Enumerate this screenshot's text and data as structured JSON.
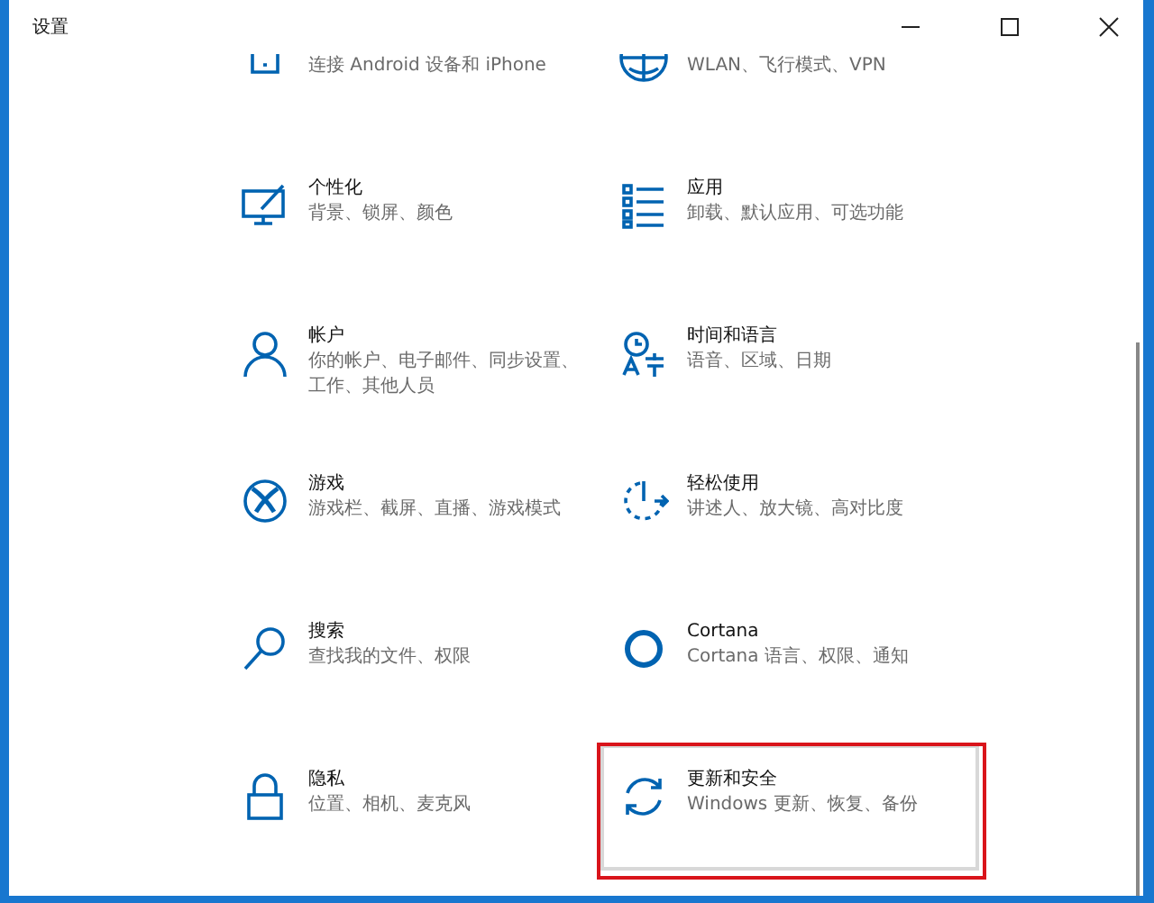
{
  "window": {
    "title": "设置"
  },
  "items": [
    {
      "description": "连接 Android 设备和 iPhone",
      "hovered": false,
      "highlighted": false
    },
    {
      "description": "WLAN、飞行模式、VPN",
      "hovered": false,
      "highlighted": false
    },
    {
      "title": "个性化",
      "description": "背景、锁屏、颜色",
      "hovered": false,
      "highlighted": false
    },
    {
      "title": "应用",
      "description": "卸载、默认应用、可选功能",
      "hovered": false,
      "highlighted": false
    },
    {
      "title": "帐户",
      "description": "你的帐户、电子邮件、同步设置、工作、其他人员",
      "hovered": false,
      "highlighted": false
    },
    {
      "title": "时间和语言",
      "description": "语音、区域、日期",
      "hovered": false,
      "highlighted": false
    },
    {
      "title": "游戏",
      "description": "游戏栏、截屏、直播、游戏模式",
      "hovered": false,
      "highlighted": false
    },
    {
      "title": "轻松使用",
      "description": "讲述人、放大镜、高对比度",
      "hovered": false,
      "highlighted": false
    },
    {
      "title": "搜索",
      "description": "查找我的文件、权限",
      "hovered": false,
      "highlighted": false
    },
    {
      "title": "Cortana",
      "description": "Cortana 语言、权限、通知",
      "hovered": false,
      "highlighted": false
    },
    {
      "title": "隐私",
      "description": "位置、相机、麦克风",
      "hovered": false,
      "highlighted": false
    },
    {
      "title": "更新和安全",
      "description": "Windows 更新、恢复、备份",
      "hovered": true,
      "highlighted": true
    }
  ]
}
